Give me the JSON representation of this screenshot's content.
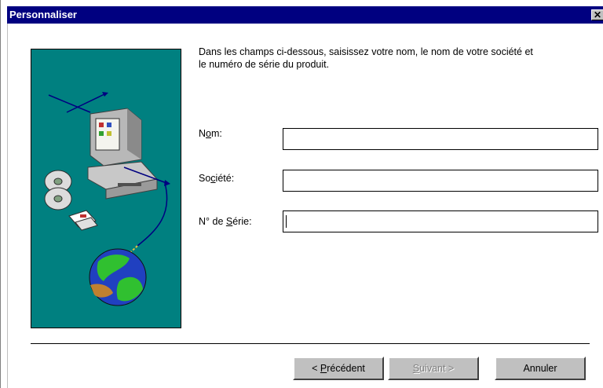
{
  "window": {
    "title": "Personnaliser",
    "close_glyph": "✕"
  },
  "intro": {
    "line1": "Dans les champs ci-dessous, saisissez votre nom, le nom de votre société et",
    "line2": "le numéro de série du produit."
  },
  "form": {
    "name": {
      "pre": "N",
      "mnemonic": "o",
      "post": "m:",
      "value": ""
    },
    "company": {
      "pre": "So",
      "mnemonic": "c",
      "post": "iété:",
      "value": ""
    },
    "serial": {
      "pre": "N° de ",
      "mnemonic": "S",
      "post": "érie:",
      "value": ""
    }
  },
  "buttons": {
    "back": {
      "pre": "< ",
      "mnemonic": "P",
      "post": "récédent"
    },
    "next": {
      "pre": "",
      "mnemonic": "S",
      "post": "uivant >"
    },
    "cancel": "Annuler"
  },
  "icons": [
    "computer-icon",
    "cd-icon",
    "floppy-disk-icon",
    "globe-icon"
  ],
  "colors": {
    "titlebar": "#000080",
    "illustration_bg": "#008080",
    "button_face": "#c0c0c0"
  }
}
